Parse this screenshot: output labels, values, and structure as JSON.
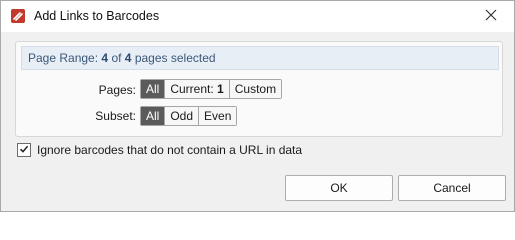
{
  "window": {
    "title": "Add Links to Barcodes",
    "close_icon": "close-icon",
    "app_icon": "pdf-editor-icon"
  },
  "page_range": {
    "prefix": "Page Range:",
    "selected": "4",
    "of": "of",
    "total": "4",
    "suffix": "pages selected"
  },
  "pages": {
    "label": "Pages:",
    "options": [
      "All",
      "Current:",
      "1",
      "Custom"
    ],
    "selected": "All"
  },
  "subset": {
    "label": "Subset:",
    "options": [
      "All",
      "Odd",
      "Even"
    ],
    "selected": "All"
  },
  "ignore_checkbox": {
    "label": "Ignore barcodes that do not contain a URL in data",
    "checked": true
  },
  "buttons": {
    "ok": "OK",
    "cancel": "Cancel"
  },
  "colors": {
    "active_segment": "#5b5b5b",
    "range_bar": "#e8eef5",
    "app_icon": "#c0392b"
  }
}
